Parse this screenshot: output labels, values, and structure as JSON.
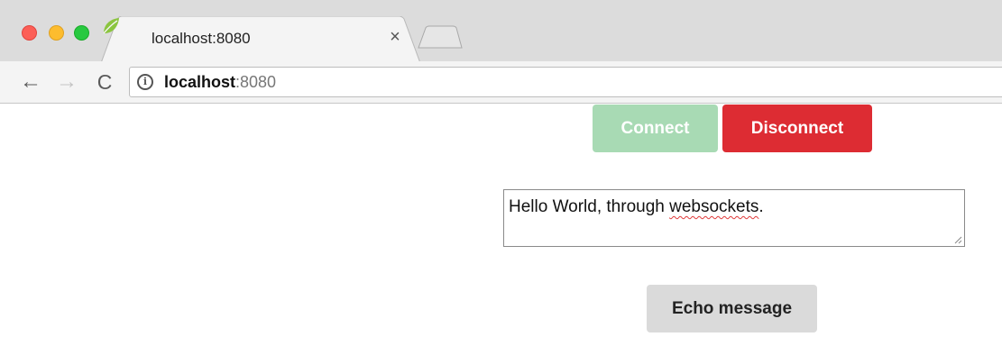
{
  "browser": {
    "tab": {
      "title": "localhost:8080",
      "favicon": "spring-leaf-icon",
      "close_glyph": "×"
    },
    "address_bar": {
      "host": "localhost",
      "port": ":8080"
    },
    "nav": {
      "back_glyph": "←",
      "forward_glyph": "→",
      "reload_glyph": "C"
    }
  },
  "page": {
    "connect_label": "Connect",
    "disconnect_label": "Disconnect",
    "message": {
      "prefix": "Hello World, through ",
      "misspelled": "websockets",
      "suffix": "."
    },
    "echo_label": "Echo message"
  },
  "colors": {
    "connect_bg": "#a8dab4",
    "disconnect_bg": "#dd2c33",
    "echo_bg": "#dadada"
  }
}
